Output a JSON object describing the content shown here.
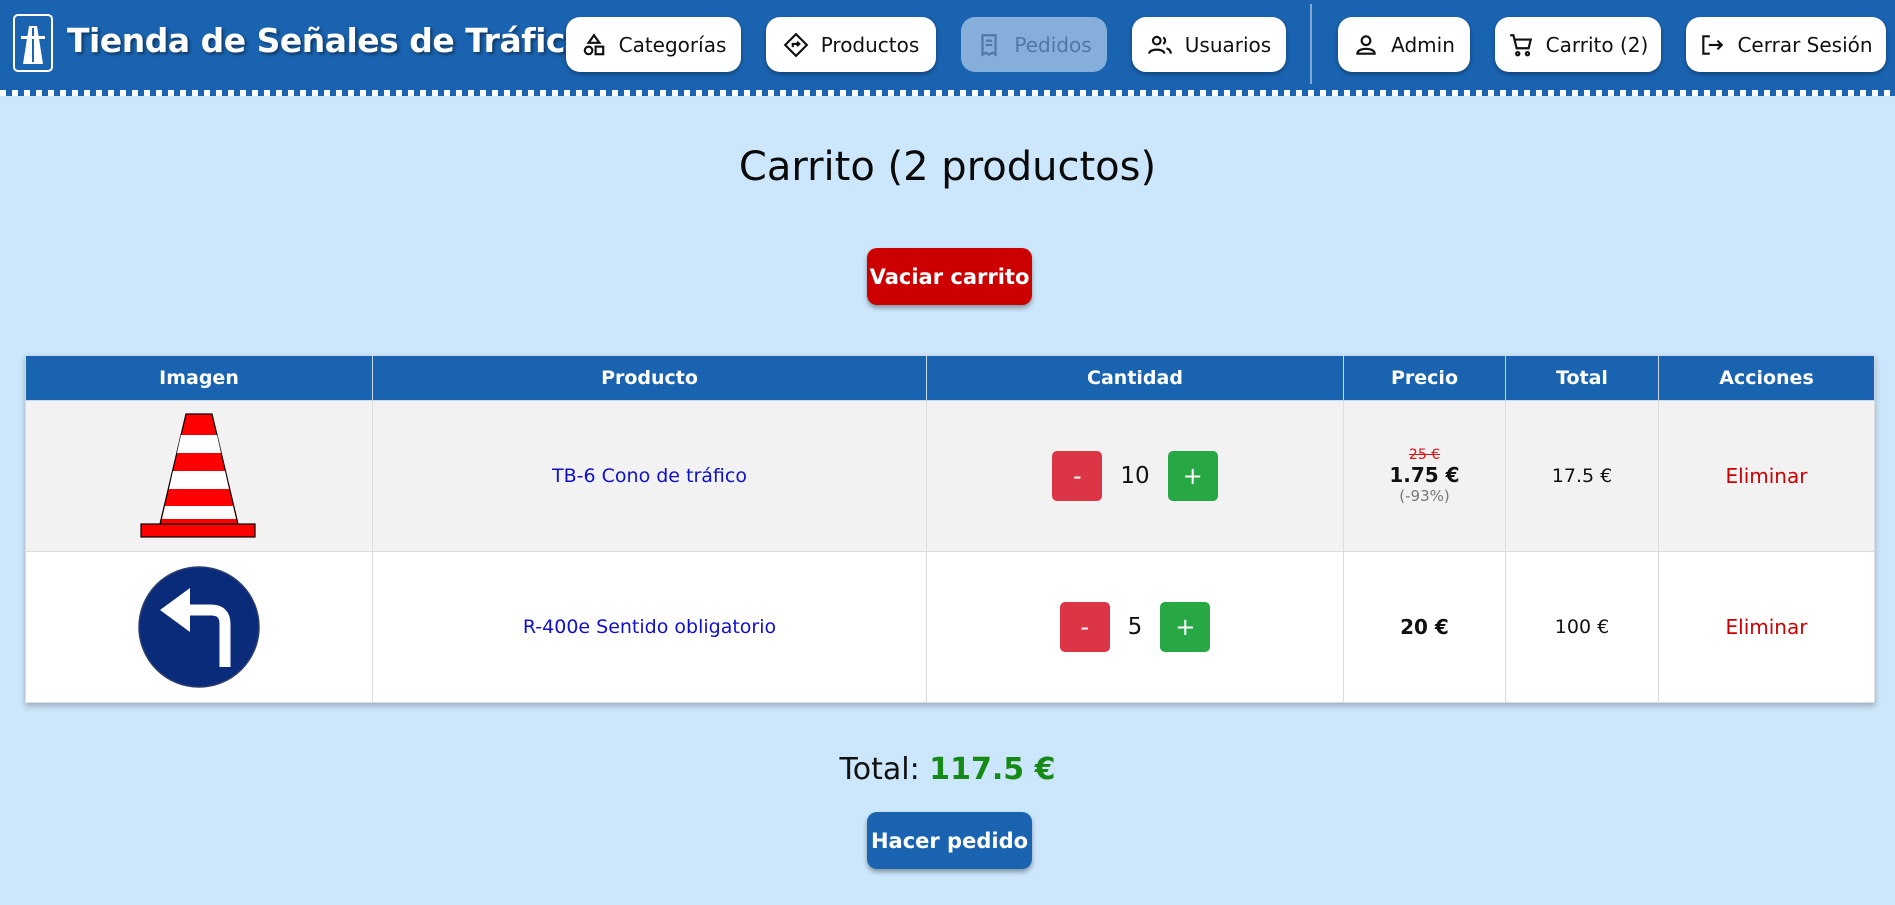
{
  "header": {
    "site_title": "Tienda de Señales de Tráfico",
    "logo_icon": "highway-icon",
    "nav": {
      "categorias": "Categorías",
      "productos": "Productos",
      "pedidos": "Pedidos",
      "usuarios": "Usuarios",
      "admin": "Admin",
      "carrito": "Carrito (2)",
      "cerrar_sesion": "Cerrar Sesión"
    }
  },
  "main": {
    "title": "Carrito (2 productos)",
    "clear_button": "Vaciar carrito",
    "table": {
      "headers": [
        "Imagen",
        "Producto",
        "Cantidad",
        "Precio",
        "Total",
        "Acciones"
      ],
      "rows": [
        {
          "image": "traffic-cone",
          "product": "TB-6 Cono de tráfico",
          "qty_minus": "-",
          "quantity": "10",
          "qty_plus": "+",
          "old_price": "25 €",
          "price": "1.75 €",
          "discount": "(-93%)",
          "total": "17.5 €",
          "action": "Eliminar"
        },
        {
          "image": "turn-left-sign",
          "product": "R-400e Sentido obligatorio",
          "qty_minus": "-",
          "quantity": "5",
          "qty_plus": "+",
          "price": "20 €",
          "total": "100 €",
          "action": "Eliminar"
        }
      ]
    },
    "total_label": "Total:",
    "total_amount": "117.5 €",
    "order_button": "Hacer pedido"
  },
  "colors": {
    "header_bg": "#1a63b0",
    "page_bg": "#cce6fb",
    "danger": "#cc0000",
    "success": "#28a745",
    "total_green": "#168a16"
  }
}
